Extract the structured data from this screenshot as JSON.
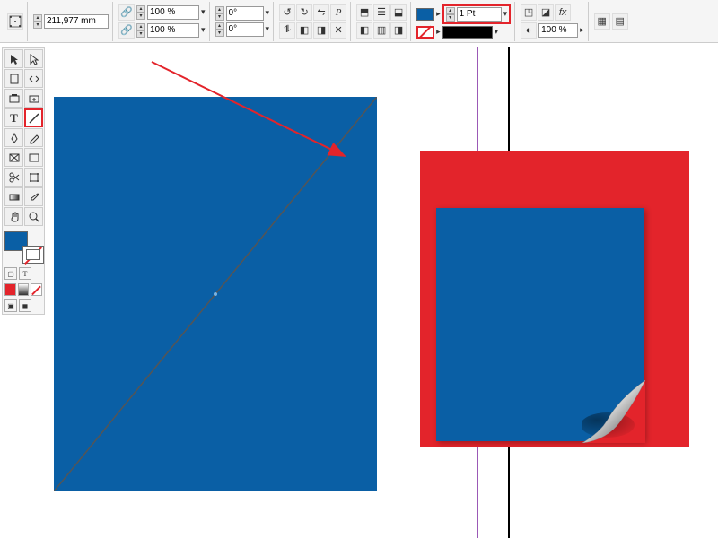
{
  "toolbar": {
    "dimension_value": "211,977 mm",
    "scale_x": "100 %",
    "scale_y": "100 %",
    "rotation": "0°",
    "shear": "0°",
    "stroke_weight": "1 Pt",
    "opacity": "100 %",
    "fill_color": "#0a5fa5",
    "stroke_color": "#000000"
  },
  "tools": {
    "selection": "selection-tool",
    "direct_selection": "direct-selection-tool",
    "page": "page-tool",
    "gap": "gap-tool",
    "content_collector": "content-collector-tool",
    "content_placer": "content-placer-tool",
    "type": "type-tool",
    "line": "line-tool",
    "pen": "pen-tool",
    "pencil": "pencil-tool",
    "rectangle_frame": "rectangle-frame-tool",
    "rectangle": "rectangle-tool",
    "scissors": "scissors-tool",
    "free_transform": "free-transform-tool",
    "gradient": "gradient-swatch-tool",
    "eyedropper": "eyedropper-tool",
    "hand": "hand-tool",
    "zoom": "zoom-tool"
  },
  "colors": {
    "fill": "#0a5fa5",
    "stroke": "none",
    "accent_red": "#e3242b",
    "canvas_blue": "#0a5fa5"
  },
  "labels": {
    "type_abbrev": "T",
    "paragraph_abbrev": "P",
    "fx": "fx"
  }
}
